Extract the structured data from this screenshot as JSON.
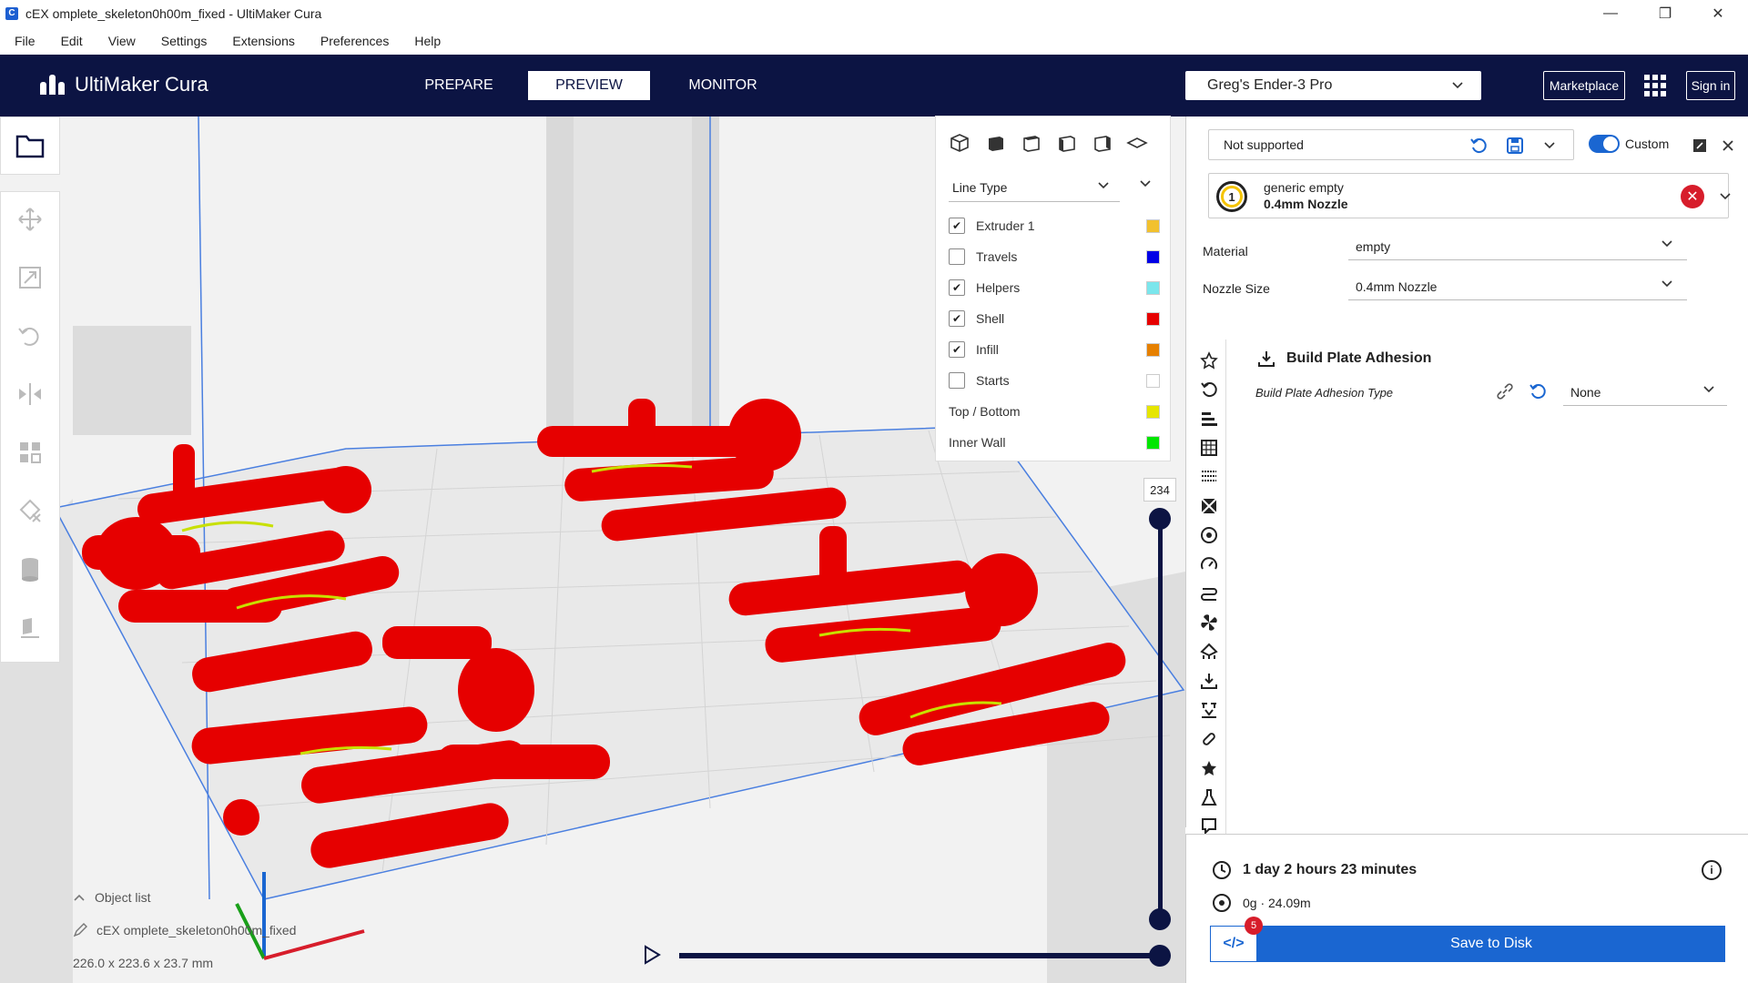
{
  "window": {
    "title": "cEX omplete_skeleton0h00m_fixed - UltiMaker Cura",
    "minimize": "—",
    "maximize": "❐",
    "close": "✕"
  },
  "menu": [
    "File",
    "Edit",
    "View",
    "Settings",
    "Extensions",
    "Preferences",
    "Help"
  ],
  "header": {
    "logo": "UltiMaker Cura",
    "tabs": [
      "PREPARE",
      "PREVIEW",
      "MONITOR"
    ],
    "active_tab": "PREVIEW",
    "printer": "Greg's Ender-3 Pro",
    "marketplace": "Marketplace",
    "sign_in": "Sign in"
  },
  "line_panel": {
    "color_scheme": "Line Type",
    "items": [
      {
        "label": "Extruder 1",
        "checkbox": true,
        "checked": true,
        "color": "#f2c12e"
      },
      {
        "label": "Travels",
        "checkbox": true,
        "checked": false,
        "color": "#0000e6"
      },
      {
        "label": "Helpers",
        "checkbox": true,
        "checked": true,
        "color": "#7be6ec"
      },
      {
        "label": "Shell",
        "checkbox": true,
        "checked": true,
        "color": "#e60000"
      },
      {
        "label": "Infill",
        "checkbox": true,
        "checked": true,
        "color": "#e68000"
      },
      {
        "label": "Starts",
        "checkbox": true,
        "checked": false,
        "color": "#ffffff"
      },
      {
        "label": "Top / Bottom",
        "checkbox": false,
        "checked": false,
        "color": "#e6e600"
      },
      {
        "label": "Inner Wall",
        "checkbox": false,
        "checked": false,
        "color": "#00e600"
      }
    ]
  },
  "layer_slider": {
    "value": "234"
  },
  "object": {
    "list_label": "Object list",
    "name": "cEX omplete_skeleton0h00m_fixed",
    "dimensions": "226.0 x 223.6 x 23.7 mm"
  },
  "print_settings": {
    "profile": "Not supported",
    "custom_label": "Custom",
    "extruder_number": "1",
    "material_name": "generic empty",
    "nozzle_name": "0.4mm Nozzle",
    "material_label": "Material",
    "material_value": "empty",
    "nozzle_label": "Nozzle Size",
    "nozzle_value": "0.4mm Nozzle",
    "section_title": "Build Plate Adhesion",
    "setting_label": "Build Plate Adhesion Type",
    "setting_value": "None"
  },
  "print_info": {
    "time": "1 day 2 hours 23 minutes",
    "material": "0g · 24.09m",
    "badge": "5",
    "save": "Save to Disk"
  },
  "colors": {
    "header_bg": "#0c1443",
    "accent": "#1a66d1",
    "error": "#d71d2b",
    "model": "#e60000"
  }
}
